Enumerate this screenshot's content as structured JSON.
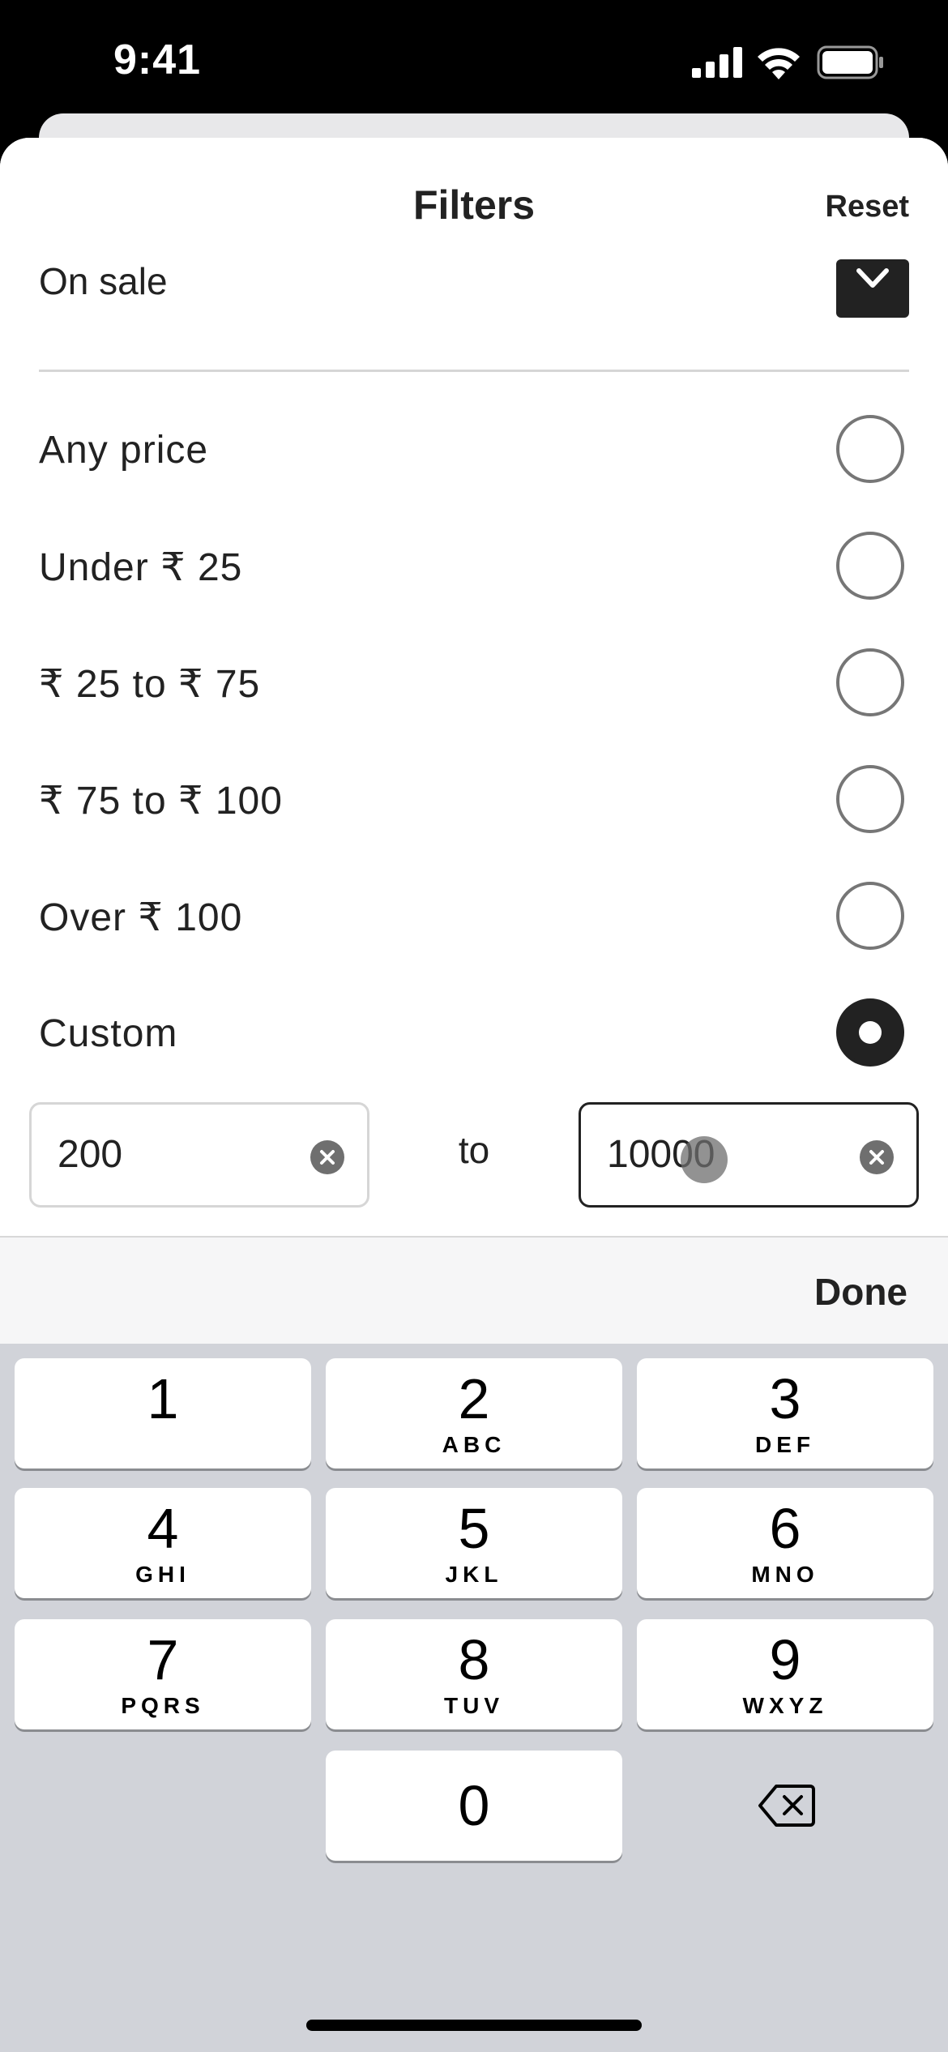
{
  "status_bar": {
    "time": "9:41"
  },
  "sheet": {
    "title": "Filters",
    "reset_label": "Reset"
  },
  "on_sale": {
    "label": "On sale",
    "checked": true
  },
  "price_options": [
    {
      "label": "Any price",
      "selected": false
    },
    {
      "label": "Under ₹ 25",
      "selected": false
    },
    {
      "label": "₹ 25 to ₹ 75",
      "selected": false
    },
    {
      "label": "₹ 75 to ₹ 100",
      "selected": false
    },
    {
      "label": "Over ₹ 100",
      "selected": false
    },
    {
      "label": "Custom",
      "selected": true
    }
  ],
  "custom_range": {
    "min_value": "200",
    "to_label": "to",
    "max_value": "10000"
  },
  "keyboard": {
    "done_label": "Done",
    "keys": [
      {
        "digit": "1",
        "letters": ""
      },
      {
        "digit": "2",
        "letters": "ABC"
      },
      {
        "digit": "3",
        "letters": "DEF"
      },
      {
        "digit": "4",
        "letters": "GHI"
      },
      {
        "digit": "5",
        "letters": "JKL"
      },
      {
        "digit": "6",
        "letters": "MNO"
      },
      {
        "digit": "7",
        "letters": "PQRS"
      },
      {
        "digit": "8",
        "letters": "TUV"
      },
      {
        "digit": "9",
        "letters": "WXYZ"
      },
      {
        "digit": "0",
        "letters": ""
      }
    ]
  },
  "colors": {
    "text": "#222222",
    "sheet": "#ffffff",
    "keyboard_bg": "#d1d3d9",
    "radio_border": "#767676"
  }
}
